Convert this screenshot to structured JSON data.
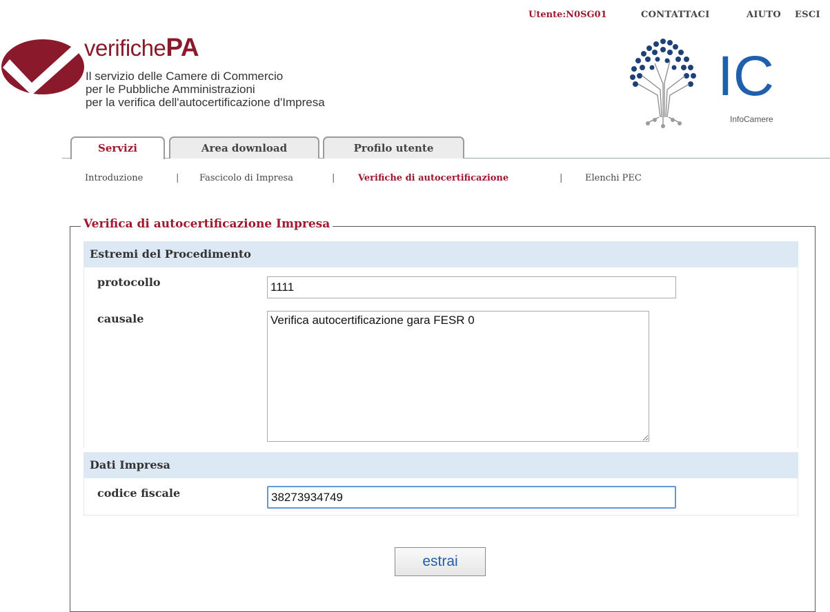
{
  "header": {
    "user_label": "Utente:N0SG01",
    "links": [
      "CONTATTACI",
      "AIUTO",
      "ESCI"
    ]
  },
  "brand": {
    "name_part1": "verifiche",
    "name_part2": "PA",
    "tagline_line1": "Il servizio delle Camere di Commercio",
    "tagline_line2": "per le Pubbliche Amministrazioni",
    "tagline_line3": "per la verifica dell'autocertificazione d'Impresa",
    "partner_logo_text": "IC",
    "partner_name": "InfoCamere"
  },
  "tabs": [
    {
      "label": "Servizi",
      "active": true
    },
    {
      "label": "Area download",
      "active": false
    },
    {
      "label": "Profilo utente",
      "active": false
    }
  ],
  "subnav": {
    "items": [
      "Introduzione",
      "Fascicolo di Impresa",
      "Verifiche di autocertificazione",
      "Elenchi PEC"
    ],
    "separator": "|",
    "current": "Verifiche di autocertificazione"
  },
  "form": {
    "legend": "Verifica di autocertificazione Impresa",
    "section1_title": "Estremi del Procedimento",
    "protocollo_label": "protocollo",
    "protocollo_value": "1111",
    "causale_label": "causale",
    "causale_value": "Verifica autocertificazione gara FESR 0",
    "section2_title": "Dati Impresa",
    "cf_label": "codice fiscale",
    "cf_value": "38273934749",
    "submit_label": "estrai"
  },
  "colors": {
    "accent": "#a0192e",
    "section_bg": "#dde8f5",
    "link_blue": "#1f5fa8",
    "focus_border": "#5b9ad8"
  }
}
